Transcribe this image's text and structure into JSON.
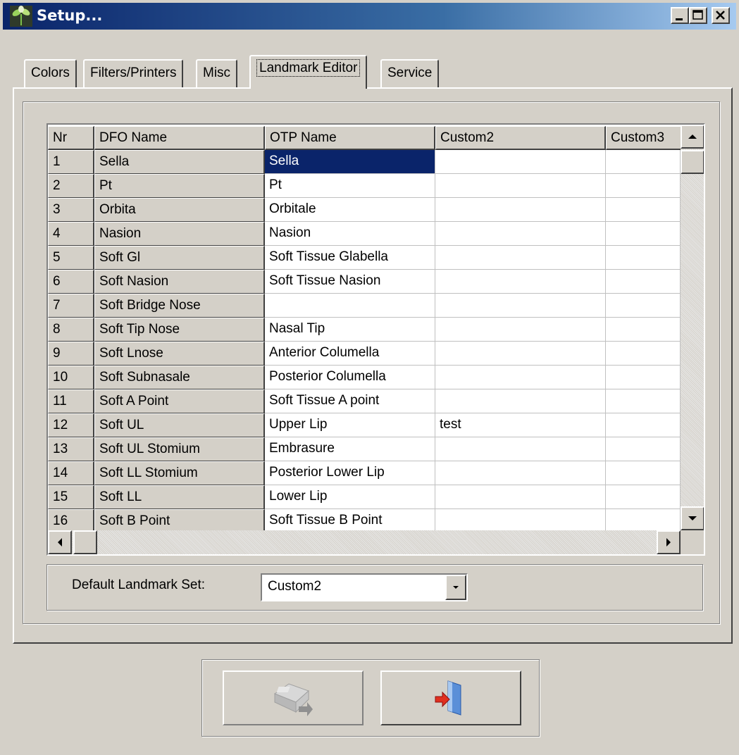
{
  "window": {
    "title": "Setup..."
  },
  "tabs": [
    {
      "label": "Colors"
    },
    {
      "label": "Filters/Printers"
    },
    {
      "label": "Misc"
    },
    {
      "label": "Landmark Editor"
    },
    {
      "label": "Service"
    }
  ],
  "grid": {
    "columns": [
      "Nr",
      "DFO Name",
      "OTP Name",
      "Custom2",
      "Custom3"
    ],
    "rows": [
      {
        "nr": "1",
        "dfo": "Sella",
        "otp": "Sella",
        "custom2": "",
        "custom3": ""
      },
      {
        "nr": "2",
        "dfo": "Pt",
        "otp": "Pt",
        "custom2": "",
        "custom3": ""
      },
      {
        "nr": "3",
        "dfo": "Orbita",
        "otp": "Orbitale",
        "custom2": "",
        "custom3": ""
      },
      {
        "nr": "4",
        "dfo": "Nasion",
        "otp": "Nasion",
        "custom2": "",
        "custom3": ""
      },
      {
        "nr": "5",
        "dfo": "Soft Gl",
        "otp": "Soft Tissue Glabella",
        "custom2": "",
        "custom3": ""
      },
      {
        "nr": "6",
        "dfo": "Soft Nasion",
        "otp": "Soft Tissue Nasion",
        "custom2": "",
        "custom3": ""
      },
      {
        "nr": "7",
        "dfo": "Soft Bridge Nose",
        "otp": "",
        "custom2": "",
        "custom3": ""
      },
      {
        "nr": "8",
        "dfo": "Soft Tip Nose",
        "otp": "Nasal Tip",
        "custom2": "",
        "custom3": ""
      },
      {
        "nr": "9",
        "dfo": "Soft Lnose",
        "otp": "Anterior Columella",
        "custom2": "",
        "custom3": ""
      },
      {
        "nr": "10",
        "dfo": "Soft Subnasale",
        "otp": "Posterior Columella",
        "custom2": "",
        "custom3": ""
      },
      {
        "nr": "11",
        "dfo": "Soft A Point",
        "otp": "Soft Tissue A point",
        "custom2": "",
        "custom3": ""
      },
      {
        "nr": "12",
        "dfo": "Soft UL",
        "otp": "Upper Lip",
        "custom2": "test",
        "custom3": ""
      },
      {
        "nr": "13",
        "dfo": "Soft UL Stomium",
        "otp": "Embrasure",
        "custom2": "",
        "custom3": ""
      },
      {
        "nr": "14",
        "dfo": "Soft LL Stomium",
        "otp": "Posterior Lower Lip",
        "custom2": "",
        "custom3": ""
      },
      {
        "nr": "15",
        "dfo": "Soft LL",
        "otp": "Lower Lip",
        "custom2": "",
        "custom3": ""
      },
      {
        "nr": "16",
        "dfo": "Soft B Point",
        "otp": "Soft Tissue B Point",
        "custom2": "",
        "custom3": ""
      }
    ],
    "selected_cell": "OTP Name row 1"
  },
  "default_set": {
    "label": "Default Landmark Set:",
    "value": "Custom2"
  },
  "buttons": {
    "save_icon": "save-disk-icon",
    "exit_icon": "exit-door-icon",
    "save_enabled": false
  },
  "colors": {
    "titlebar_start": "#0a246a",
    "selection": "#0a246a",
    "face": "#d4d0c8"
  }
}
